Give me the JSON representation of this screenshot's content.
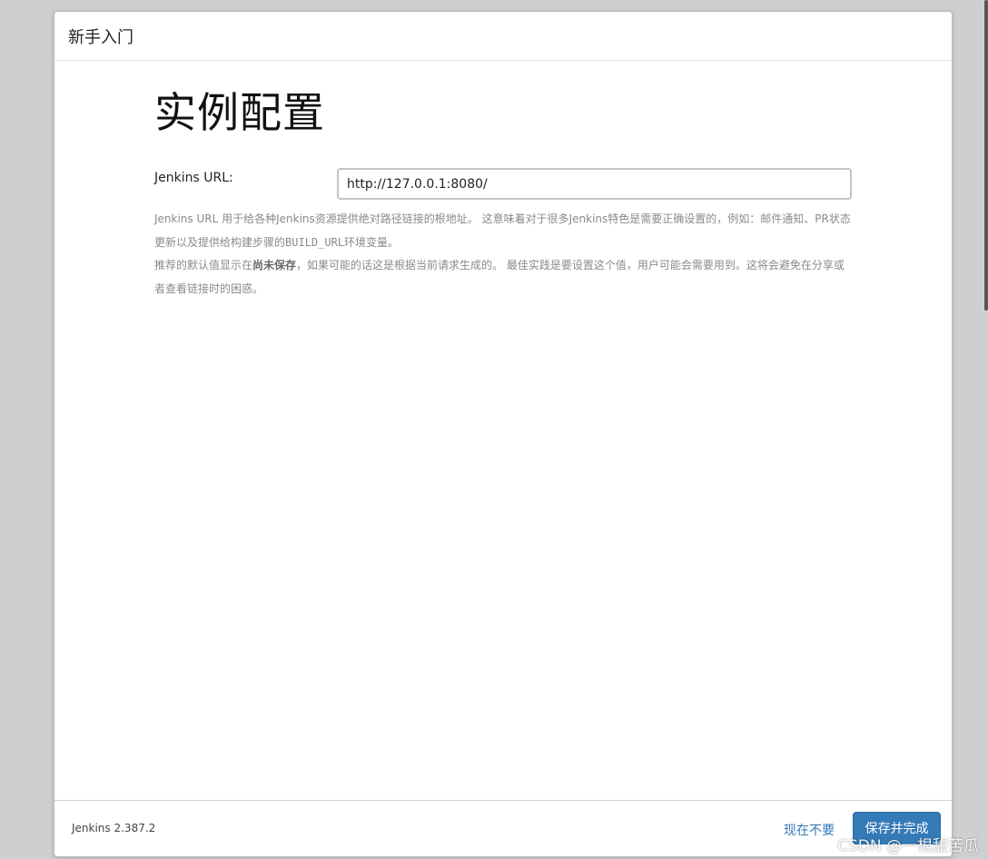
{
  "dialog": {
    "title": "新手入门"
  },
  "main": {
    "heading": "实例配置",
    "url_label": "Jenkins URL:",
    "url_value": "http://127.0.0.1:8080/",
    "help_line1": "Jenkins URL 用于给各种Jenkins资源提供绝对路径链接的根地址。 这意味着对于很多Jenkins特色是需要正确设置的，例如：邮件通知、PR状态更新以及提供给构建步骤的",
    "help_code": "BUILD_URL",
    "help_line1_end": "环境变量。",
    "help_line2_start": "推荐的默认值显示在",
    "help_strong": "尚未保存",
    "help_line2_end": "，如果可能的话这是根据当前请求生成的。 最佳实践是要设置这个值，用户可能会需要用到。这将会避免在分享或者查看链接时的困惑。"
  },
  "footer": {
    "version": "Jenkins 2.387.2",
    "skip_label": "现在不要",
    "save_label": "保存并完成"
  },
  "watermark": "CSDN @一根甜苦瓜"
}
